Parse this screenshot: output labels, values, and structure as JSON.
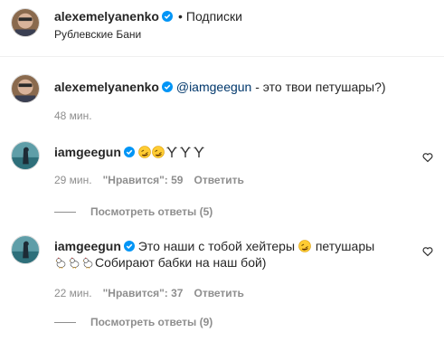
{
  "header": {
    "username": "alexemelyanenko",
    "follow_status": "Подписки",
    "location": "Рублевские Бани"
  },
  "caption": {
    "username": "alexemelyanenko",
    "mention": "@iamgeegun",
    "text": " - это твои петушары?)",
    "time": "48 мин."
  },
  "comments": [
    {
      "username": "iamgeegun",
      "emojis": [
        "rolling-laughing-emoji",
        "rolling-laughing-emoji",
        "rooster-emoji",
        "rooster-emoji",
        "rooster-emoji"
      ],
      "time": "29 мин.",
      "likes": "\"Нравится\": 59",
      "reply": "Ответить",
      "view_replies": "Посмотреть ответы (5)"
    },
    {
      "username": "iamgeegun",
      "text_1": "Это наши с тобой хейтеры",
      "text_2": "петушары",
      "text_3": "Собирают бабки на наш бой)",
      "time": "22 мин.",
      "likes": "\"Нравится\": 37",
      "reply": "Ответить",
      "view_replies": "Посмотреть ответы (9)"
    }
  ],
  "colors": {
    "text": "#262626",
    "muted": "#8e8e8e",
    "verified": "#0095f6",
    "mention": "#00376b"
  }
}
